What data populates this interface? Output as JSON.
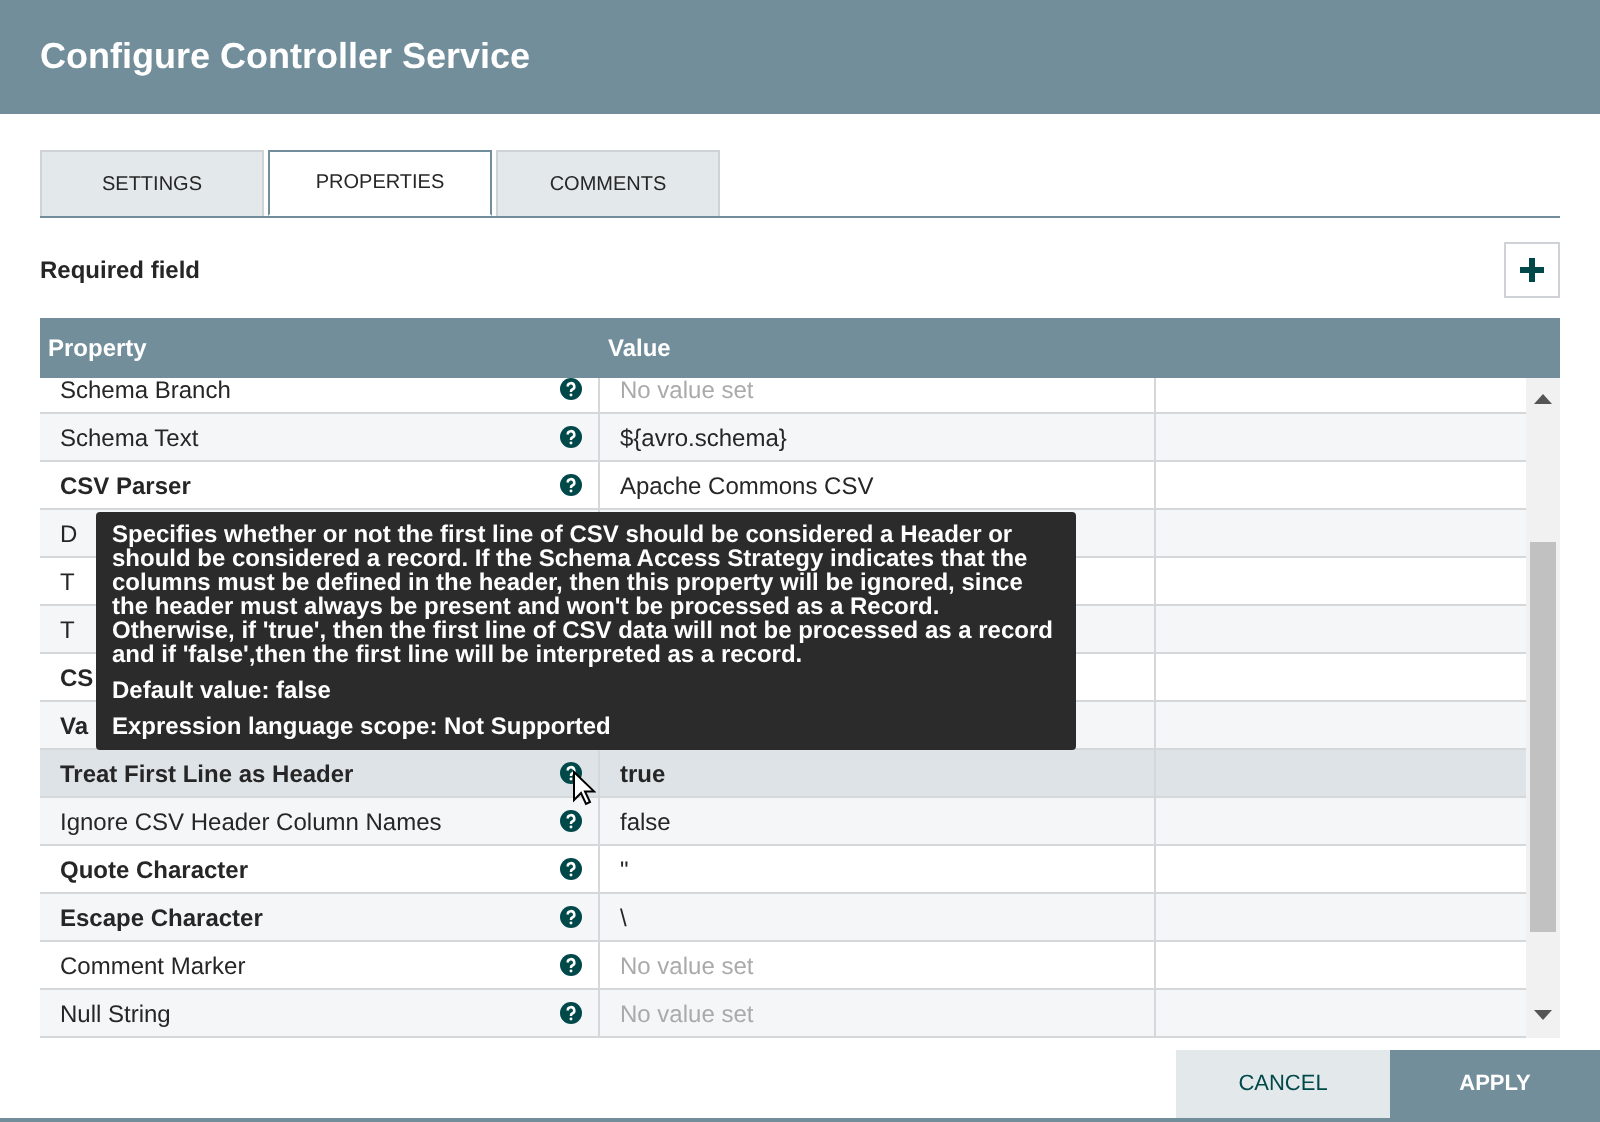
{
  "window": {
    "title": "Configure Controller Service"
  },
  "tabs": [
    {
      "label": "SETTINGS",
      "selected": false
    },
    {
      "label": "PROPERTIES",
      "selected": true
    },
    {
      "label": "COMMENTS",
      "selected": false
    }
  ],
  "required_note": "Required field",
  "table": {
    "columns": [
      "Property",
      "Value"
    ],
    "rows": [
      {
        "name": "Schema Branch",
        "value": "No value set",
        "value_set": false,
        "required": false,
        "selected": false
      },
      {
        "name": "Schema Text",
        "value": "${avro.schema}",
        "value_set": true,
        "required": false,
        "selected": false
      },
      {
        "name": "CSV Parser",
        "value": "Apache Commons CSV",
        "value_set": true,
        "required": true,
        "selected": false
      },
      {
        "name": "D",
        "required": false,
        "selected": false
      },
      {
        "name": "T",
        "required": false,
        "selected": false
      },
      {
        "name": "T",
        "required": false,
        "selected": false
      },
      {
        "name": "CS",
        "required": true,
        "selected": false
      },
      {
        "name": "Va",
        "required": true,
        "selected": false
      },
      {
        "name": "Treat First Line as Header",
        "value": "true",
        "value_set": true,
        "required": true,
        "selected": true
      },
      {
        "name": "Ignore CSV Header Column Names",
        "value": "false",
        "value_set": true,
        "required": false,
        "selected": false
      },
      {
        "name": "Quote Character",
        "value": "\"",
        "value_set": true,
        "required": true,
        "selected": false
      },
      {
        "name": "Escape Character",
        "value": "\\",
        "value_set": true,
        "required": true,
        "selected": false
      },
      {
        "name": "Comment Marker",
        "value": "No value set",
        "value_set": false,
        "required": false,
        "selected": false
      },
      {
        "name": "Null String",
        "value": "No value set",
        "value_set": false,
        "required": false,
        "selected": false
      }
    ]
  },
  "tooltip": {
    "description": "Specifies whether or not the first line of CSV should be considered a Header or should be considered a record. If the Schema Access Strategy indicates that the columns must be defined in the header, then this property will be ignored, since the header must always be present and won't be processed as a Record. Otherwise, if 'true', then the first line of CSV data will not be processed as a record and if 'false',then the first line will be interpreted as a record.",
    "default_value": "Default value: false",
    "scope": "Expression language scope: Not Supported"
  },
  "buttons": [
    {
      "label": "CANCEL",
      "kind": "secondary"
    },
    {
      "label": "APPLY",
      "kind": "primary"
    }
  ]
}
